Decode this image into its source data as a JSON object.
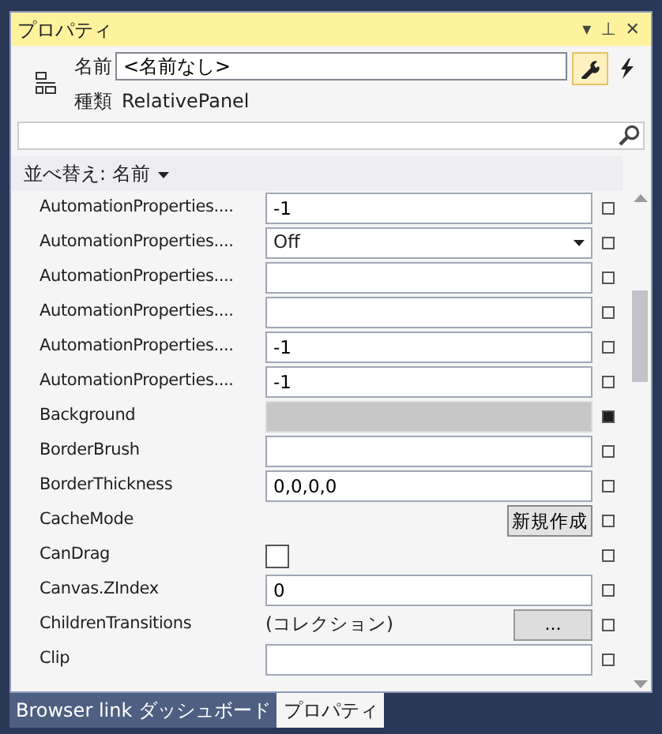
{
  "window": {
    "title": "プロパティ",
    "title_buttons": [
      "▾",
      "⊥",
      "✕"
    ]
  },
  "header": {
    "name_label": "名前",
    "name_value": "<名前なし>",
    "type_label": "種類",
    "type_value": "RelativePanel",
    "tools": [
      {
        "kind": "properties",
        "selected": true
      },
      {
        "kind": "events",
        "selected": false
      }
    ]
  },
  "sort": {
    "label": "並べ替え: 名前"
  },
  "properties": [
    {
      "name": "AutomationProperties....",
      "kind": "text",
      "value": "-1",
      "set": false
    },
    {
      "name": "AutomationProperties....",
      "kind": "dropdown",
      "value": "Off",
      "set": false
    },
    {
      "name": "AutomationProperties....",
      "kind": "text",
      "set": false
    },
    {
      "name": "AutomationProperties....",
      "kind": "text",
      "set": false
    },
    {
      "name": "AutomationProperties....",
      "kind": "text",
      "value": "-1",
      "set": false
    },
    {
      "name": "AutomationProperties....",
      "kind": "text",
      "value": "-1",
      "set": false
    },
    {
      "name": "Background",
      "kind": "color",
      "color": "#c6c6c6",
      "set": true
    },
    {
      "name": "BorderBrush",
      "kind": "text",
      "set": false
    },
    {
      "name": "BorderThickness",
      "kind": "text",
      "value": "0,0,0,0",
      "set": false
    },
    {
      "name": "CacheMode",
      "kind": "button",
      "value": "新規作成",
      "set": false
    },
    {
      "name": "CanDrag",
      "kind": "checkbox",
      "checked": false,
      "set": false
    },
    {
      "name": "Canvas.ZIndex",
      "kind": "text",
      "value": "0",
      "set": false
    },
    {
      "name": "ChildrenTransitions",
      "kind": "collection",
      "value": "(コレクション)",
      "button": "...",
      "set": false
    },
    {
      "name": "Clip",
      "kind": "text",
      "set": false
    }
  ],
  "bottom_tabs": [
    {
      "label": "Browser link ダッシュボード",
      "selected": false
    },
    {
      "label": "プロパティ",
      "selected": true
    }
  ]
}
